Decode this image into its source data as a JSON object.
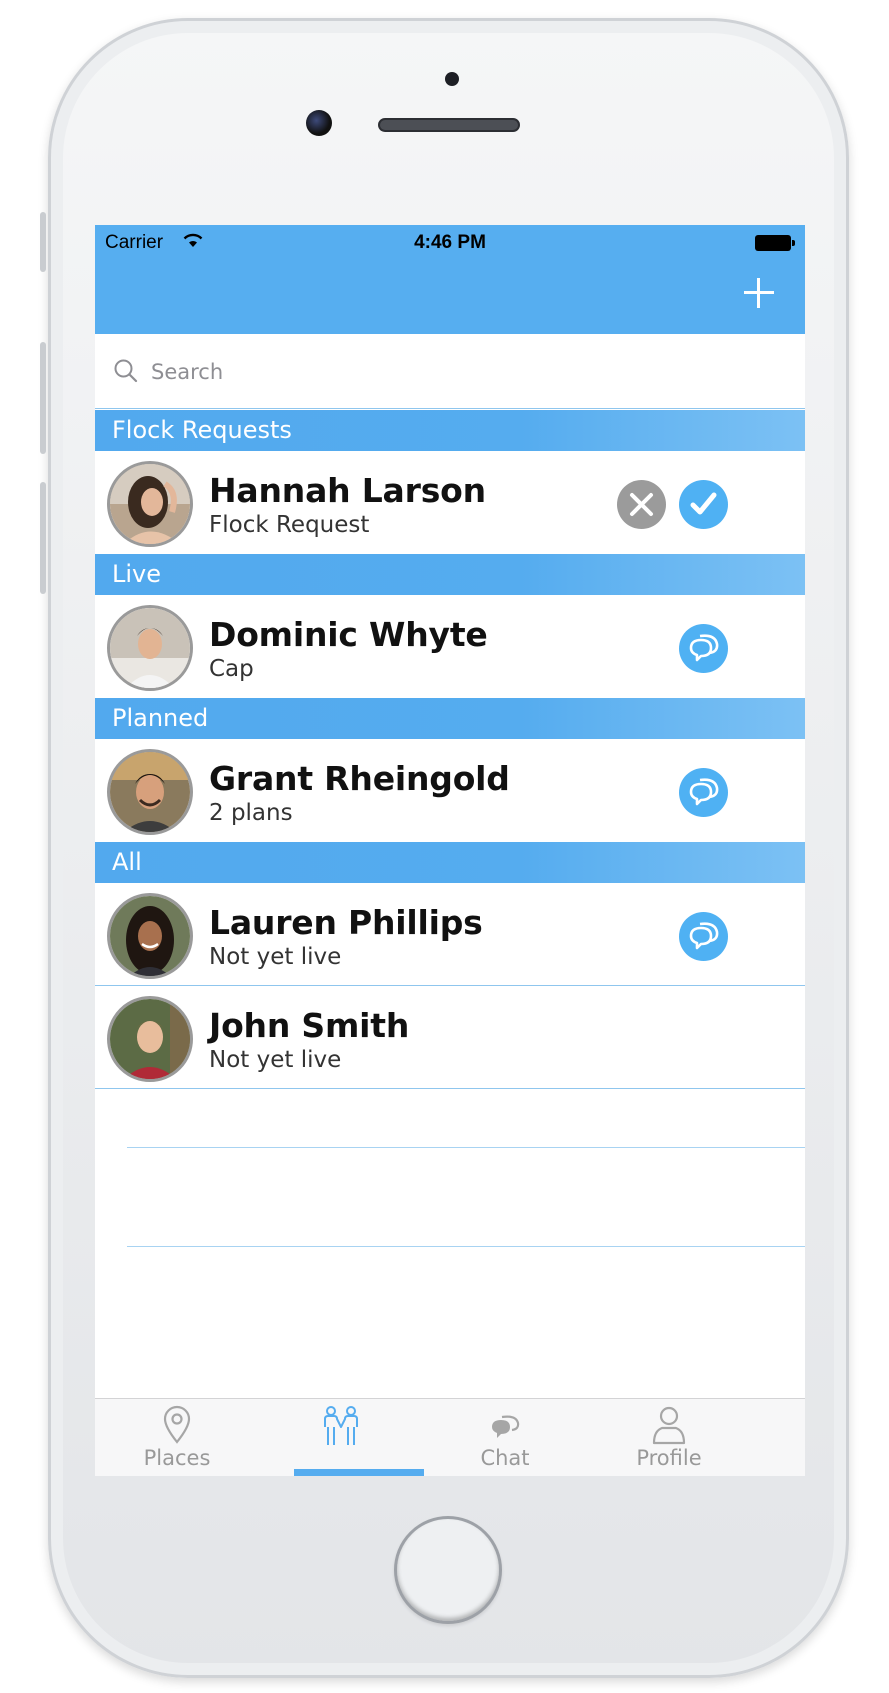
{
  "status_bar": {
    "carrier": "Carrier",
    "time": "4:46 PM"
  },
  "search": {
    "placeholder": "Search"
  },
  "sections": {
    "flock_requests": "Flock Requests",
    "live": "Live",
    "planned": "Planned",
    "all": "All"
  },
  "rows": {
    "hannah": {
      "name": "Hannah Larson",
      "subtitle": "Flock Request"
    },
    "dominic": {
      "name": "Dominic Whyte",
      "subtitle": "Cap"
    },
    "grant": {
      "name": "Grant Rheingold",
      "subtitle": "2 plans"
    },
    "lauren": {
      "name": "Lauren Phillips",
      "subtitle": "Not yet live"
    },
    "john": {
      "name": "John Smith",
      "subtitle": "Not yet live"
    }
  },
  "tabs": {
    "places": "Places",
    "flock": "",
    "chat": "Chat",
    "profile": "Profile"
  },
  "icons": {
    "add": "plus-icon",
    "search": "search-icon",
    "decline": "x-circle-icon",
    "accept": "check-circle-icon",
    "chat": "chat-bubble-icon",
    "places": "location-pin-icon",
    "flock": "people-icon",
    "profile": "person-icon"
  },
  "colors": {
    "accent": "#56aef0",
    "section_header": "#52a9ee",
    "decline_gray": "#9b9b9b",
    "tab_inactive": "#999999"
  },
  "active_tab": "flock"
}
